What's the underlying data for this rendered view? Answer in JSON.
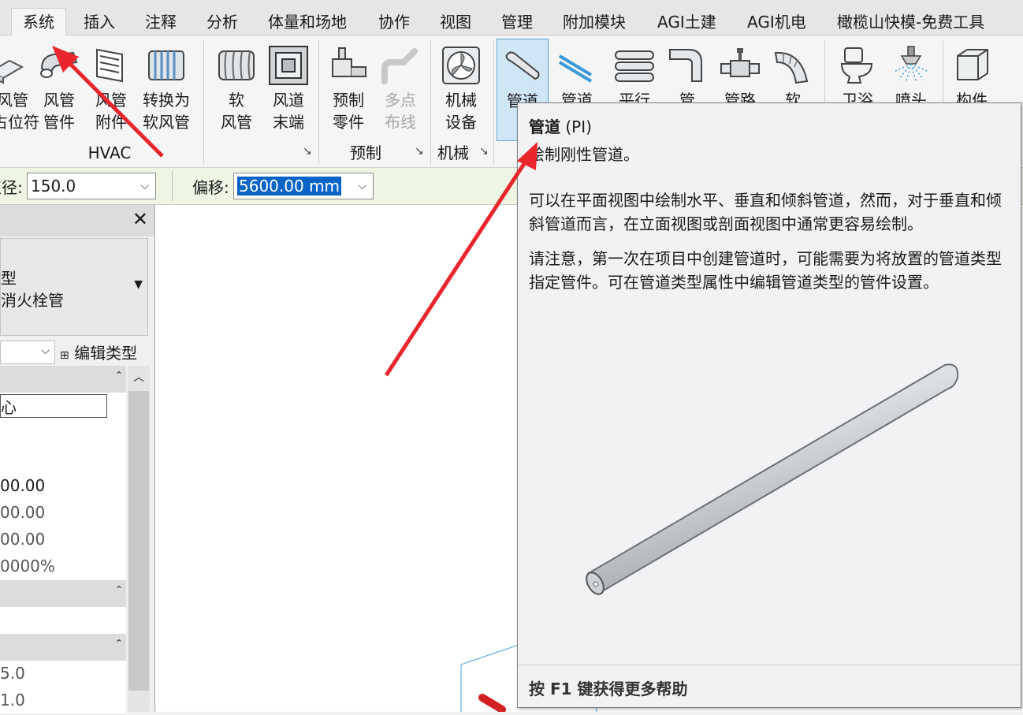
{
  "tabs": [
    "系统",
    "插入",
    "注释",
    "分析",
    "体量和场地",
    "协作",
    "视图",
    "管理",
    "附加模块",
    "AGI土建",
    "AGI机电",
    "橄榄山快模-免费工具"
  ],
  "ribbon": {
    "buttons": {
      "b0": "风管\n占位符",
      "b1": "风管\n管件",
      "b2": "风管\n附件",
      "b3": "转换为\n软风管",
      "b4": "软\n风管",
      "b5": "风道\n末端",
      "b6": "预制\n零件",
      "b7": "多点\n布线",
      "b8": "机械\n设备",
      "b9": "管道",
      "b10": "管道",
      "b11": "平行",
      "b12": "管",
      "b13": "管路",
      "b14": "软",
      "b15": "卫浴",
      "b16": "喷头",
      "b17": "构件"
    },
    "panels": {
      "hvac": "HVAC",
      "fab": "预制",
      "mech": "机械"
    },
    "launcher": "↘"
  },
  "options": {
    "diameter_label": "直径:",
    "diameter_value": "150.0",
    "offset_label": "偏移:",
    "offset_value": "5600.00 mm"
  },
  "properties": {
    "close": "✕",
    "type_line1": "型",
    "type_line2": "消火栓管",
    "edit_type": "编辑类型",
    "rows": [
      "心",
      "",
      "",
      "00.00",
      "00.00",
      "00.00",
      "0000%",
      "",
      "",
      "",
      "5.0",
      "1.0"
    ]
  },
  "tooltip": {
    "title": "管道",
    "shortcut": "(PI)",
    "summary": "绘制刚性管道。",
    "para1": "可以在平面视图中绘制水平、垂直和倾斜管道，然而，对于垂直和倾斜管道而言，在立面视图或剖面视图中通常更容易绘制。",
    "para2": "请注意，第一次在项目中创建管道时，可能需要为将放置的管道类型指定管件。可在管道类型属性中编辑管道类型的管件设置。",
    "footer": "按 F1 键获得更多帮助"
  },
  "colors": {
    "annotation_arrow": "#e8262b",
    "highlight": "#cfe6f7",
    "selection": "#0a64c8",
    "options_bar": "#eef5e2"
  },
  "icons": [
    "duct-placeholder-icon",
    "duct-fitting-icon",
    "duct-accessory-icon",
    "convert-flex-icon",
    "flex-duct-icon",
    "air-terminal-icon",
    "fabrication-part-icon",
    "multipoint-routing-icon",
    "mechanical-equipment-icon",
    "pipe-icon",
    "pipe-placeholder-icon",
    "parallel-pipes-icon",
    "pipe-fitting-icon",
    "pipe-accessory-icon",
    "flex-pipe-icon",
    "plumbing-fixture-icon",
    "sprinkler-icon",
    "component-icon"
  ]
}
